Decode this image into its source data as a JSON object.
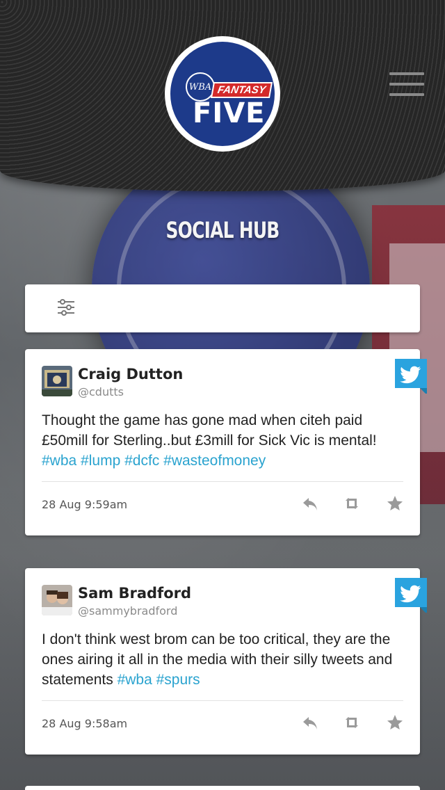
{
  "app": {
    "logo_monogram": "WBA",
    "logo_fantasy": "FANTASY",
    "logo_five": "FIVE"
  },
  "page": {
    "title": "SOCIAL HUB"
  },
  "icons": {
    "menu": "hamburger-menu-icon",
    "filter": "sliders-icon",
    "twitter": "twitter-bird-icon",
    "reply": "reply-icon",
    "retweet": "retweet-icon",
    "favorite": "star-icon"
  },
  "colors": {
    "hashtag": "#2aa3cf",
    "twitter_blue": "#2aa3df",
    "action_gray": "#9a9a9a",
    "logo_blue": "#1d3a8a",
    "logo_red": "#d42a2a"
  },
  "tweets": [
    {
      "name": "Craig Dutton",
      "handle": "@cdutts",
      "text_parts": [
        "Thought the game has gone mad when citeh paid £50mill for Sterling..but £3mill for Sick Vic is mental! ",
        "#wba",
        " ",
        "#lump",
        " ",
        "#dcfc",
        " ",
        "#wasteofmoney"
      ],
      "time": "28 Aug 9:59am"
    },
    {
      "name": "Sam Bradford",
      "handle": "@sammybradford",
      "text_parts": [
        "I don't think west brom can be too critical, they are the ones airing it all in the media with their silly tweets and statements ",
        "#wba",
        " ",
        "#spurs"
      ],
      "time": "28 Aug 9:58am"
    }
  ]
}
